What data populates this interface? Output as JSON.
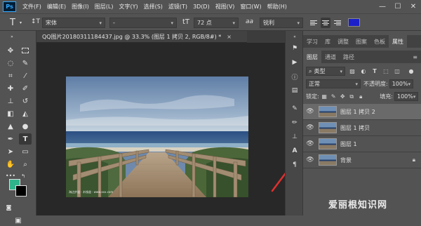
{
  "menubar": {
    "logo": "Ps",
    "items": [
      "文件(F)",
      "编辑(E)",
      "图像(I)",
      "图层(L)",
      "文字(Y)",
      "选择(S)",
      "滤镜(T)",
      "3D(D)",
      "视图(V)",
      "窗口(W)",
      "帮助(H)"
    ],
    "window_controls": [
      "—",
      "☐",
      "✕"
    ]
  },
  "options_bar": {
    "tool_icon": "T",
    "orientation_icon": "↕T",
    "font_family": "宋体",
    "font_style": "-",
    "size_icon": "tT",
    "font_size": "72 点",
    "aa_icon": "aa",
    "anti_alias": "锐利",
    "text_color": "#1b20c8"
  },
  "document": {
    "tab_title": "QQ图片20180311184437.jpg @ 33.3% (图层 1 拷贝 2, RGB/8#) *",
    "close_label": "×",
    "photo_caption": "海边步道 · 木栈道 · www.xxx.com"
  },
  "panels": {
    "tabs_top": [
      {
        "label": "学习",
        "active": false
      },
      {
        "label": "库",
        "active": false
      },
      {
        "label": "调整",
        "active": false
      },
      {
        "label": "图案",
        "active": false
      },
      {
        "label": "色板",
        "active": false
      },
      {
        "label": "属性",
        "active": true
      }
    ],
    "tabs_layers": [
      {
        "label": "图层",
        "active": true
      },
      {
        "label": "通道",
        "active": false
      },
      {
        "label": "路径",
        "active": false
      }
    ],
    "filter_kind": "类型",
    "blend_mode": "正常",
    "opacity_label": "不透明度:",
    "opacity_value": "100%",
    "lock_label": "锁定:",
    "fill_label": "填充:",
    "fill_value": "100%",
    "layers": [
      {
        "name": "图层 1 拷贝 2",
        "selected": true,
        "locked": false
      },
      {
        "name": "图层 1 拷贝",
        "selected": false,
        "locked": false
      },
      {
        "name": "图层 1",
        "selected": false,
        "locked": false
      },
      {
        "name": "背景",
        "selected": false,
        "locked": true
      }
    ]
  },
  "colors": {
    "foreground": "#2fb38a",
    "background": "#000000",
    "annotation_arrow": "#e0302f"
  },
  "watermark": "爱丽根知识网"
}
